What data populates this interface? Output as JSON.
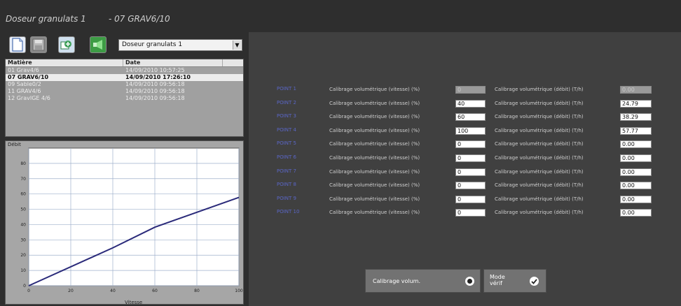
{
  "header": {
    "title": "Doseur granulats 1",
    "subtitle": "- 07 GRAV6/10"
  },
  "toolbar": {
    "icons": [
      "new-document-icon",
      "save-icon",
      "copy-recipe-icon",
      "export-icon"
    ],
    "selector_value": "Doseur granulats 1"
  },
  "recipe_list": {
    "columns": [
      "Matière",
      "Date"
    ],
    "rows": [
      {
        "material": "01 Grav4/6",
        "date": "14/09/2010 10:57:25",
        "selected": false
      },
      {
        "material": "07 GRAV6/10",
        "date": "14/09/2010 17:26:10",
        "selected": true
      },
      {
        "material": "09 Sable0/2",
        "date": "14/09/2010 09:56:18",
        "selected": false
      },
      {
        "material": "11 GRAV4/6",
        "date": "14/09/2010 09:56:18",
        "selected": false
      },
      {
        "material": "12 GravIGE 4/6",
        "date": "14/09/2010 09:56:18",
        "selected": false
      }
    ]
  },
  "chart_data": {
    "type": "line",
    "xlabel": "Vitesse",
    "ylabel": "Débit",
    "xlim": [
      0,
      100
    ],
    "ylim": [
      0,
      90
    ],
    "xticks": [
      0,
      20,
      40,
      60,
      80,
      100
    ],
    "yticks": [
      0,
      10,
      20,
      30,
      40,
      50,
      60,
      70,
      80
    ],
    "grid": true,
    "series": [
      {
        "color": "#2a2a7a",
        "x": [
          0,
          40,
          60,
          100
        ],
        "y": [
          0,
          24.79,
          38.29,
          57.77
        ]
      }
    ]
  },
  "calibration": {
    "speed_label": "Calibrage volumétrique (vitesse) (%)",
    "flow_label": "Calibrage volumétrique (débit) (T/h)",
    "points": [
      {
        "name": "POINT 1",
        "speed": "0",
        "flow": "0.00",
        "disabled": true
      },
      {
        "name": "POINT 2",
        "speed": "40",
        "flow": "24.79",
        "disabled": false
      },
      {
        "name": "POINT 3",
        "speed": "60",
        "flow": "38.29",
        "disabled": false
      },
      {
        "name": "POINT 4",
        "speed": "100",
        "flow": "57.77",
        "disabled": false
      },
      {
        "name": "POINT 5",
        "speed": "0",
        "flow": "0.00",
        "disabled": false
      },
      {
        "name": "POINT 6",
        "speed": "0",
        "flow": "0.00",
        "disabled": false
      },
      {
        "name": "POINT 7",
        "speed": "0",
        "flow": "0.00",
        "disabled": false
      },
      {
        "name": "POINT 8",
        "speed": "0",
        "flow": "0.00",
        "disabled": false
      },
      {
        "name": "POINT 9",
        "speed": "0",
        "flow": "0.00",
        "disabled": false
      },
      {
        "name": "POINT 10",
        "speed": "0",
        "flow": "0.00",
        "disabled": false
      }
    ]
  },
  "buttons": {
    "calibrate_label": "Calibrage volum.",
    "mode_line1": "Mode",
    "mode_line2": "vérif"
  }
}
